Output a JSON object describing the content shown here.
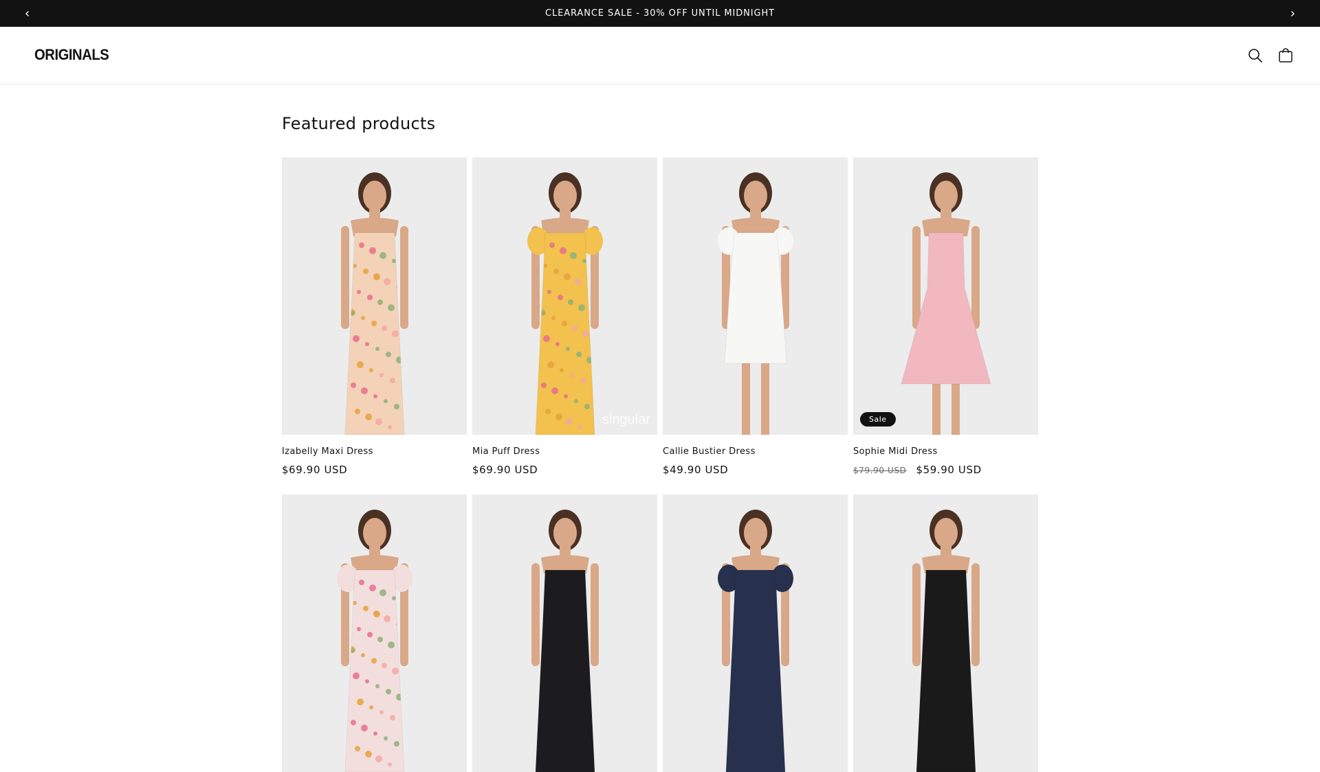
{
  "announcement": {
    "text": "CLEARANCE SALE - 30% OFF UNTIL MIDNIGHT"
  },
  "header": {
    "logo": "ORIGINALS",
    "icons": [
      "search-icon",
      "cart-icon"
    ]
  },
  "section": {
    "title": "Featured products"
  },
  "products": [
    {
      "title": "Izabelly Maxi Dress",
      "price": "$69.90 USD",
      "dress_color": "#f3d2b8",
      "pattern": "floral"
    },
    {
      "title": "Mia Puff Dress",
      "price": "$69.90 USD",
      "dress_color": "#f2c14e",
      "pattern": "floral",
      "watermark": "singular"
    },
    {
      "title": "Callie Bustier Dress",
      "price": "$49.90 USD",
      "dress_color": "#f7f7f5",
      "pattern": "solid"
    },
    {
      "title": "Sophie Midi Dress",
      "price_old": "$79.90 USD",
      "price": "$59.90 USD",
      "dress_color": "#f2b8bf",
      "pattern": "solid",
      "badge": "Sale"
    },
    {
      "title": "",
      "price": "",
      "dress_color": "#f3dede",
      "pattern": "floral"
    },
    {
      "title": "",
      "price": "",
      "dress_color": "#1c1c1f",
      "pattern": "solid"
    },
    {
      "title": "",
      "price": "",
      "dress_color": "#27304d",
      "pattern": "solid"
    },
    {
      "title": "",
      "price": "",
      "dress_color": "#1a1a1a",
      "pattern": "solid"
    }
  ],
  "colors": {
    "announcement_bg": "#121212",
    "badge_bg": "#121212",
    "image_bg": "#ebebeb"
  }
}
